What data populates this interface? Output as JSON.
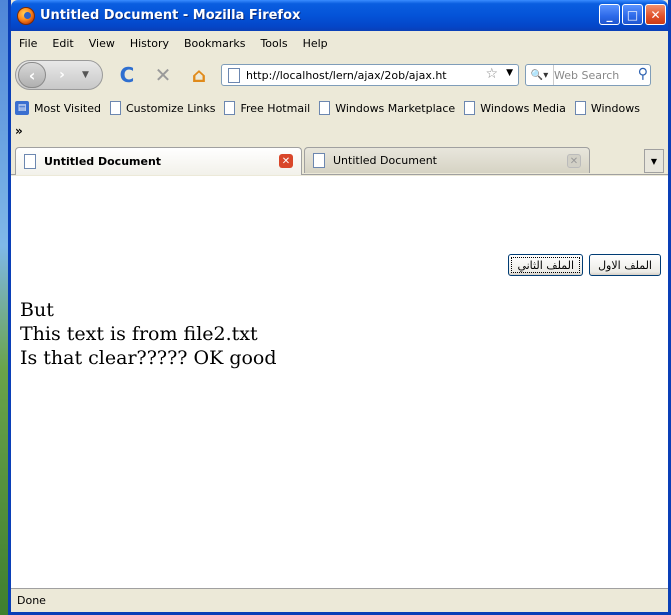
{
  "window": {
    "title": "Untitled Document - Mozilla Firefox"
  },
  "menu": [
    "File",
    "Edit",
    "View",
    "History",
    "Bookmarks",
    "Tools",
    "Help"
  ],
  "nav": {
    "url": "http://localhost/lern/ajax/2ob/ajax.ht",
    "search_placeholder": "Web Search"
  },
  "bookmarks": [
    "Most Visited",
    "Customize Links",
    "Free Hotmail",
    "Windows Marketplace",
    "Windows Media",
    "Windows"
  ],
  "overflow_chevron": "»",
  "tabs": [
    {
      "label": "Untitled Document",
      "active": true
    },
    {
      "label": "Untitled Document",
      "active": false
    }
  ],
  "page": {
    "buttons": [
      "الملف الثاني",
      "الملف الاول"
    ],
    "lines": [
      "But",
      "This text is from file2.txt",
      "Is that clear????? OK good"
    ]
  },
  "status": "Done"
}
